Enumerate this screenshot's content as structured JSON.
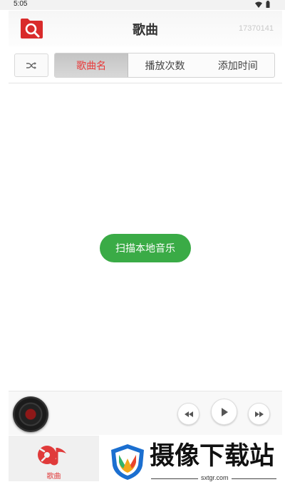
{
  "status": {
    "time": "5:05"
  },
  "header": {
    "title": "歌曲",
    "user_id": "17370141"
  },
  "sort_tabs": [
    {
      "label": "歌曲名",
      "active": true
    },
    {
      "label": "播放次数",
      "active": false
    },
    {
      "label": "添加时间",
      "active": false
    }
  ],
  "main": {
    "scan_label": "扫描本地音乐"
  },
  "bottom_nav": {
    "songs_label": "歌曲"
  },
  "watermark": {
    "text": "摄像下载站",
    "url": "sxtgr.com"
  },
  "colors": {
    "accent": "#e03a3a",
    "scan_green": "#3aab46"
  },
  "icons": [
    "wifi-icon",
    "battery-icon",
    "folder-search-icon",
    "shuffle-icon",
    "rewind-icon",
    "play-icon",
    "fast-forward-icon",
    "music-notes-icon",
    "logo-icon"
  ]
}
